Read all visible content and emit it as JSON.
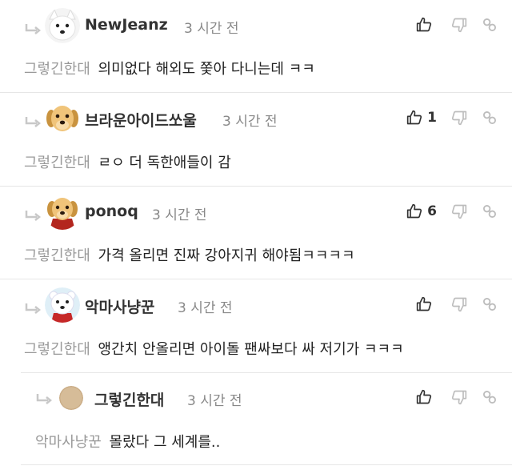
{
  "comments": [
    {
      "author": "NewJeanz",
      "time": "3 시간 전",
      "mention": "그렇긴한대",
      "text": "의미없다 해외도 쫓아 다니는데 ㅋㅋ",
      "likes": "",
      "avatar": "white-dog-avatar"
    },
    {
      "author": "브라운아이드쏘울",
      "time": "3 시간 전",
      "mention": "그렇긴한대",
      "text": "ㄹㅇ 더 독한애들이 감",
      "likes": "1",
      "avatar": "puppy-avatar"
    },
    {
      "author": "ponoq",
      "time": "3 시간 전",
      "mention": "그렇긴한대",
      "text": "가격 올리면 진짜 강아지귀 해야됨ㅋㅋㅋㅋ",
      "likes": "6",
      "avatar": "puppy-red-avatar"
    },
    {
      "author": "악마사냥꾼",
      "time": "3 시간 전",
      "mention": "그렇긴한대",
      "text": "앵간치 안올리면 아이돌 팬싸보다 싸 저기가 ㅋㅋㅋ",
      "likes": "",
      "avatar": "white-bear-avatar"
    },
    {
      "author": "그렇긴한대",
      "time": "3 시간 전",
      "mention": "악마사냥꾼",
      "text": "몰랐다 그 세계를..",
      "likes": "",
      "avatar": "plain-avatar"
    }
  ],
  "colors": {
    "mention": "#999999",
    "divider": "#e6e6e6",
    "time": "#888888"
  }
}
